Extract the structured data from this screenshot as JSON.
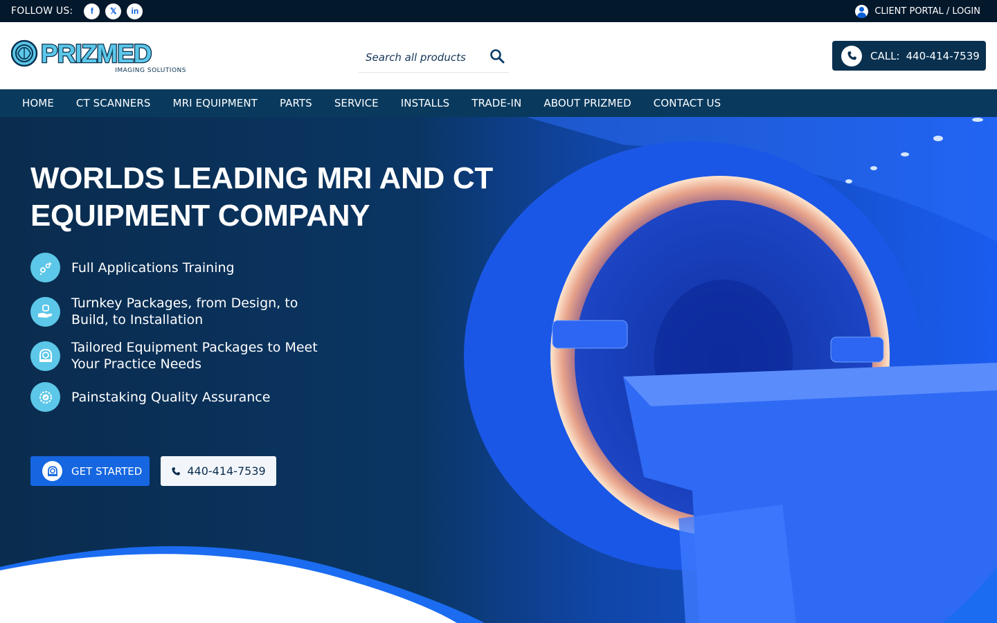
{
  "topbar": {
    "follow_label": "FOLLOW US:",
    "social": [
      {
        "icon": "facebook-icon",
        "glyph": "f"
      },
      {
        "icon": "x-icon",
        "glyph": "𝕏"
      },
      {
        "icon": "linkedin-icon",
        "glyph": "in"
      }
    ],
    "portal_label": "CLIENT PORTAL / LOGIN"
  },
  "header": {
    "logo_text": "PRIZMED",
    "logo_subtitle": "IMAGING SOLUTIONS",
    "search_placeholder": "Search all products",
    "call_label": "CALL:",
    "call_number": "440-414-7539"
  },
  "nav": {
    "items": [
      "HOME",
      "CT SCANNERS",
      "MRI EQUIPMENT",
      "PARTS",
      "SERVICE",
      "INSTALLS",
      "TRADE-IN",
      "ABOUT PRIZMED",
      "CONTACT US"
    ]
  },
  "hero": {
    "title": "WORLDS LEADING MRI AND CT EQUIPMENT COMPANY",
    "features": [
      {
        "icon": "training-icon",
        "text": "Full Applications Training"
      },
      {
        "icon": "turnkey-hand-icon",
        "text": "Turnkey Packages, from Design, to Build, to Installation"
      },
      {
        "icon": "mri-machine-icon",
        "text": "Tailored Equipment Packages to Meet Your Practice Needs"
      },
      {
        "icon": "quality-badge-icon",
        "text": "Painstaking Quality Assurance"
      }
    ],
    "cta_primary": "GET STARTED",
    "cta_phone": "440-414-7539"
  },
  "colors": {
    "topbar": "#04182c",
    "nav": "#093a5e",
    "call_button": "#09304f",
    "primary_button": "#1566e0",
    "feature_icon_bg": "#5cc7e8"
  }
}
